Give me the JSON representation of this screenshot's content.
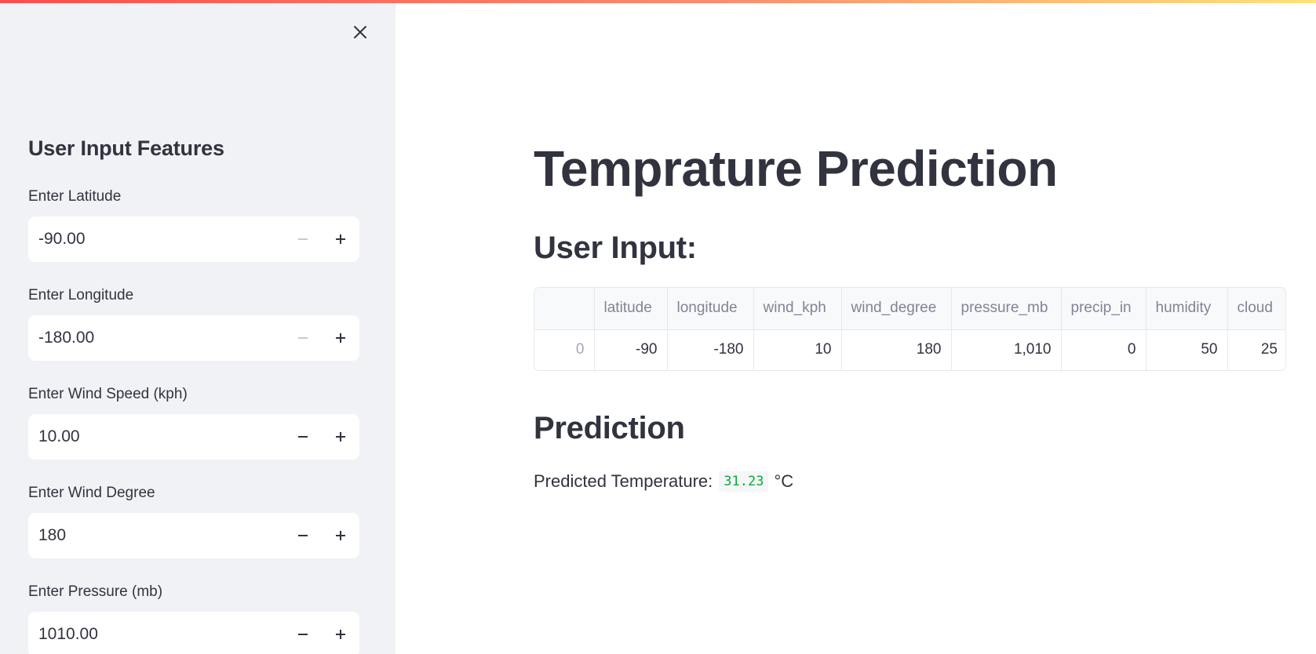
{
  "sidebar": {
    "title": "User Input Features",
    "fields": [
      {
        "label": "Enter Latitude",
        "value": "-90.00",
        "minus_disabled": true
      },
      {
        "label": "Enter Longitude",
        "value": "-180.00",
        "minus_disabled": true
      },
      {
        "label": "Enter Wind Speed (kph)",
        "value": "10.00",
        "minus_disabled": false
      },
      {
        "label": "Enter Wind Degree",
        "value": "180",
        "minus_disabled": false
      },
      {
        "label": "Enter Pressure (mb)",
        "value": "1010.00",
        "minus_disabled": false
      }
    ]
  },
  "main": {
    "title": "Temprature Prediction",
    "user_input_heading": "User Input:",
    "table": {
      "columns": [
        "",
        "latitude",
        "longitude",
        "wind_kph",
        "wind_degree",
        "pressure_mb",
        "precip_in",
        "humidity",
        "cloud"
      ],
      "rows": [
        [
          "0",
          "-90",
          "-180",
          "10",
          "180",
          "1,010",
          "0",
          "50",
          "25"
        ]
      ]
    },
    "prediction_heading": "Prediction",
    "prediction": {
      "label": "Predicted Temperature:",
      "value": "31.23",
      "unit": "°C"
    }
  },
  "colors": {
    "sidebar_bg": "#f0f2f6",
    "text": "#31333f",
    "prediction_value": "#09ab3b",
    "top_bar_start": "#ff4b4b",
    "top_bar_end": "#ffe27a"
  },
  "icons": {
    "close": "close-icon",
    "minus": "minus-icon",
    "plus": "plus-icon"
  }
}
